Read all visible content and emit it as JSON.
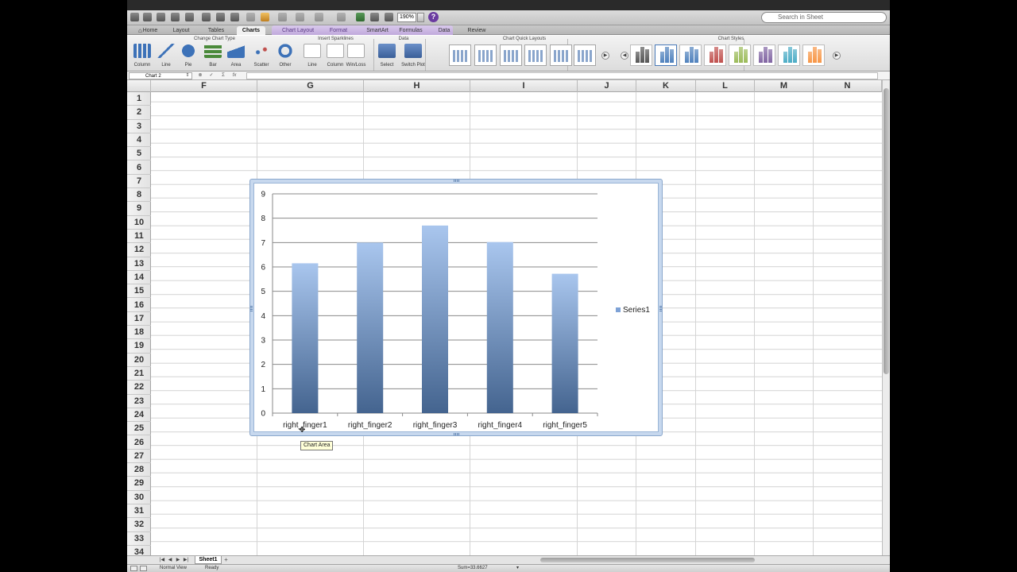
{
  "toolbar": {
    "zoom": "190%",
    "help_glyph": "?",
    "search_placeholder": "Search in Sheet"
  },
  "tabs": [
    {
      "label": "Home",
      "active": false
    },
    {
      "label": "Layout",
      "active": false
    },
    {
      "label": "Tables",
      "active": false
    },
    {
      "label": "Charts",
      "active": true
    },
    {
      "label": "Chart Layout",
      "active": false
    },
    {
      "label": "Format",
      "active": false
    },
    {
      "label": "SmartArt",
      "active": false
    },
    {
      "label": "Formulas",
      "active": false
    },
    {
      "label": "Data",
      "active": false
    },
    {
      "label": "Review",
      "active": false
    }
  ],
  "ribbon": {
    "groups": {
      "change_chart_type": "Change Chart Type",
      "insert_sparklines": "Insert Sparklines",
      "data": "Data",
      "chart_quick_layouts": "Chart Quick Layouts",
      "chart_styles": "Chart Styles"
    },
    "chart_types": [
      "Column",
      "Line",
      "Pie",
      "Bar",
      "Area",
      "Scatter",
      "Other"
    ],
    "sparklines": [
      "Line",
      "Column",
      "Win/Loss"
    ],
    "data_buttons": [
      "Select",
      "Switch Plot"
    ],
    "style_colors": [
      "#555555",
      "#4f81bd",
      "#4f81bd",
      "#c0504d",
      "#9bbb59",
      "#8064a2",
      "#4bacc6",
      "#f79646"
    ]
  },
  "formula_bar": {
    "name_box": "Chart 2",
    "fx": "fx"
  },
  "columns": [
    "F",
    "G",
    "H",
    "I",
    "J",
    "K",
    "L",
    "M",
    "N"
  ],
  "rows": [
    "1",
    "2",
    "3",
    "4",
    "5",
    "6",
    "7",
    "8",
    "9",
    "10",
    "11",
    "12",
    "13",
    "14",
    "15",
    "16",
    "17",
    "18",
    "19",
    "20",
    "21",
    "22",
    "23",
    "24",
    "25",
    "26",
    "27",
    "28",
    "29",
    "30",
    "31",
    "32",
    "33",
    "34"
  ],
  "sheet_tabs": [
    "Sheet1"
  ],
  "status": {
    "view": "Normal View",
    "state": "Ready",
    "sum": "Sum=33.6627"
  },
  "tooltip": "Chart Area",
  "chart_data": {
    "type": "bar",
    "categories": [
      "right_finger1",
      "right_finger2",
      "right_finger3",
      "right_finger4",
      "right_finger5"
    ],
    "series": [
      {
        "name": "Series1",
        "values": [
          6.15,
          7.0,
          7.7,
          7.02,
          5.72
        ]
      }
    ],
    "ylim": [
      0,
      9
    ],
    "yticks": [
      0,
      1,
      2,
      3,
      4,
      5,
      6,
      7,
      8,
      9
    ],
    "grid": true,
    "legend": "right",
    "bar_color_top": "#a9c6ee",
    "bar_color_bottom": "#44648f"
  }
}
